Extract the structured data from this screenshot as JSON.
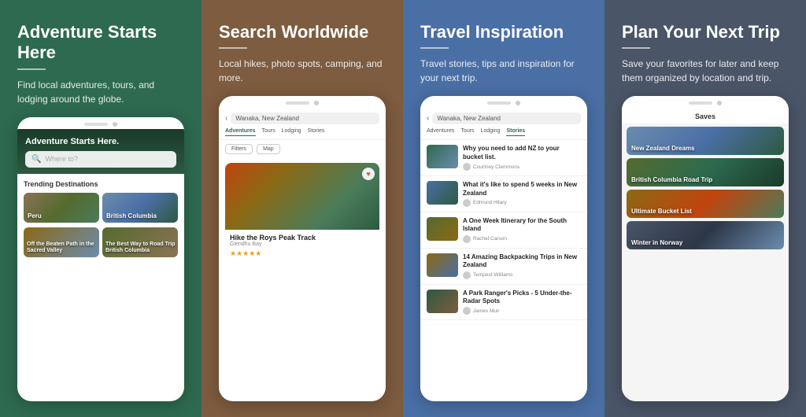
{
  "panels": [
    {
      "id": "panel-1",
      "title": "Adventure Starts Here",
      "desc": "Find local adventures, tours, and lodging around the globe.",
      "phone": {
        "hero_title": "Adventure Starts Here.",
        "search_placeholder": "Where to?",
        "trending_title": "Trending Destinations",
        "destinations": [
          {
            "label": "Peru",
            "class": "dest-peru"
          },
          {
            "label": "British Columbia",
            "class": "dest-bc"
          }
        ],
        "small_destinations": [
          {
            "label": "Off the Beaten Path in the Sacred Valley",
            "class": "dest-valley"
          },
          {
            "label": "The Best Way to Road Trip British Columbia",
            "class": "dest-road"
          }
        ]
      }
    },
    {
      "id": "panel-2",
      "title": "Search Worldwide",
      "desc": "Local hikes, photo spots, camping, and more.",
      "phone": {
        "search_value": "Wanaka, New Zealand",
        "tabs": [
          "Adventures",
          "Tours",
          "Lodging",
          "Stories"
        ],
        "active_tab": "Adventures",
        "buttons": [
          "Filters",
          "Map"
        ],
        "card": {
          "title": "Hike the Roys Peak Track",
          "subtitle": "Glendhu Bay",
          "stars": 5
        }
      }
    },
    {
      "id": "panel-3",
      "title": "Travel Inspiration",
      "desc": "Travel stories, tips and inspiration for your next trip.",
      "phone": {
        "search_value": "Wanaka, New Zealand",
        "tabs": [
          "Adventures",
          "Tours",
          "Lodging",
          "Stories"
        ],
        "active_tab": "Stories",
        "stories": [
          {
            "title": "Why you need to add NZ to your bucket list.",
            "author": "Courtney Clemmons",
            "thumb_class": "thumb-nz1"
          },
          {
            "title": "What it's like to spend 5 weeks in New Zealand",
            "author": "Edmund Hilary",
            "thumb_class": "thumb-nz2"
          },
          {
            "title": "A One Week Itinerary for the South Island",
            "author": "Rachel Carson",
            "thumb_class": "thumb-nz3"
          },
          {
            "title": "14 Amazing Backpacking Trips in New Zealand",
            "author": "Tempest Williams",
            "thumb_class": "thumb-nz4"
          },
          {
            "title": "A Park Ranger's Picks - 5 Under-the-Radar Spots",
            "author": "James Muir",
            "thumb_class": "thumb-nz5"
          }
        ]
      }
    },
    {
      "id": "panel-4",
      "title": "Plan Your Next Trip",
      "desc": "Save your favorites for later and keep them organized by location and trip.",
      "phone": {
        "saves_title": "Saves",
        "saves": [
          {
            "label": "New Zealand Dreams",
            "class": "save-nz"
          },
          {
            "label": "British Columbia Road Trip",
            "class": "save-bc"
          },
          {
            "label": "Ultimate Bucket List",
            "class": "save-bucket"
          },
          {
            "label": "Winter in Norway",
            "class": "save-norway"
          }
        ]
      }
    }
  ]
}
